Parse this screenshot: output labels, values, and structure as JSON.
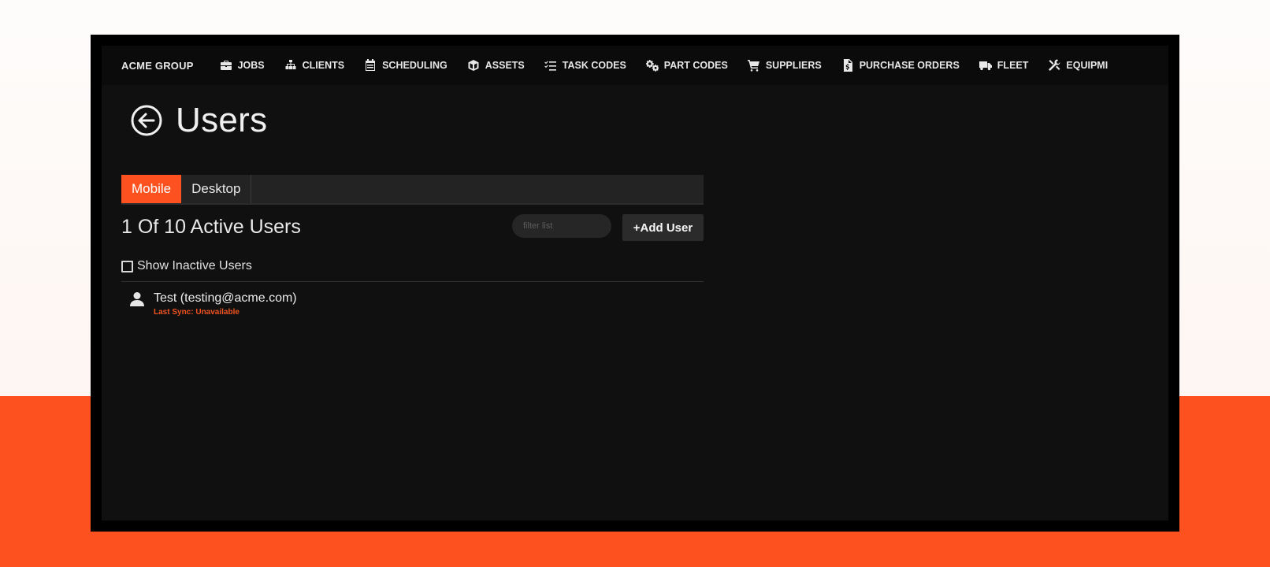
{
  "nav": {
    "brand": "ACME GROUP",
    "items": [
      {
        "label": "JOBS",
        "icon": "briefcase-icon"
      },
      {
        "label": "CLIENTS",
        "icon": "sitemap-icon"
      },
      {
        "label": "SCHEDULING",
        "icon": "calendar-icon"
      },
      {
        "label": "ASSETS",
        "icon": "cube-icon"
      },
      {
        "label": "TASK CODES",
        "icon": "task-list-icon"
      },
      {
        "label": "PART CODES",
        "icon": "gears-icon"
      },
      {
        "label": "SUPPLIERS",
        "icon": "cart-icon"
      },
      {
        "label": "PURCHASE ORDERS",
        "icon": "invoice-icon"
      },
      {
        "label": "FLEET",
        "icon": "truck-icon"
      },
      {
        "label": "EQUIPMI",
        "icon": "tools-icon"
      }
    ]
  },
  "page": {
    "title": "Users",
    "back_icon": "back-arrow-icon"
  },
  "tabs": [
    {
      "label": "Mobile",
      "active": true
    },
    {
      "label": "Desktop",
      "active": false
    }
  ],
  "users": {
    "count_text": "1 Of 10 Active Users",
    "filter_placeholder": "filter list",
    "add_label": "+Add User",
    "show_inactive_label": "Show Inactive Users",
    "show_inactive_checked": false,
    "list": [
      {
        "name": "Test (testing@acme.com)",
        "sync": "Last Sync: Unavailable",
        "icon": "user-icon"
      }
    ]
  },
  "colors": {
    "accent": "#fd5120",
    "screen_bg": "#101011",
    "nav_bg": "#0b0b0c",
    "sync_text": "#f0531f"
  }
}
